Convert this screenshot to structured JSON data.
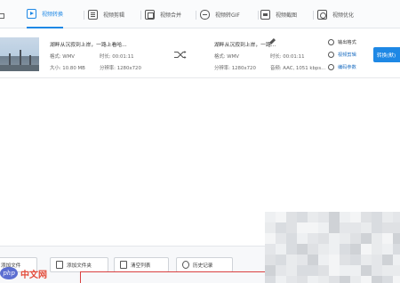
{
  "tabs": [
    {
      "label": "视频转换",
      "icon": "play-icon",
      "active": true
    },
    {
      "label": "视频剪辑",
      "icon": "doc-icon",
      "active": false
    },
    {
      "label": "视频合并",
      "icon": "merge-icon",
      "active": false
    },
    {
      "label": "视频转GIF",
      "icon": "gif-icon",
      "active": false
    },
    {
      "label": "视频截图",
      "icon": "screenshot-icon",
      "active": false
    },
    {
      "label": "视频优化",
      "icon": "optimize-icon",
      "active": false
    }
  ],
  "file": {
    "src_name": "湖畔从沉寂到上岸，一路上看哈...",
    "src_format": "格式: WMV",
    "src_duration": "时长: 00:01:11",
    "src_size": "大小: 10.80 MB",
    "src_resolution": "分辨率: 1280x720",
    "out_name": "湖畔从沉寂到上岸，一路...",
    "out_format": "格式: WMV",
    "out_duration": "时长: 00:01:11",
    "out_resolution": "分辨率: 1280x720",
    "out_audio": "音频: AAC, 1051 kbps...",
    "actions": {
      "output_format": "输出格式",
      "output_settings": "视频剪辑",
      "encode": "编码参数"
    },
    "convert_label": "转换(默)"
  },
  "bottom": {
    "add_file": "添加文件",
    "add_folder": "添加文件夹",
    "clear_list": "清空列表",
    "history": "历史记录"
  },
  "logo": {
    "left": "php",
    "right": "中文网"
  },
  "colors": {
    "accent": "#1e88e5",
    "red": "#d94040"
  }
}
